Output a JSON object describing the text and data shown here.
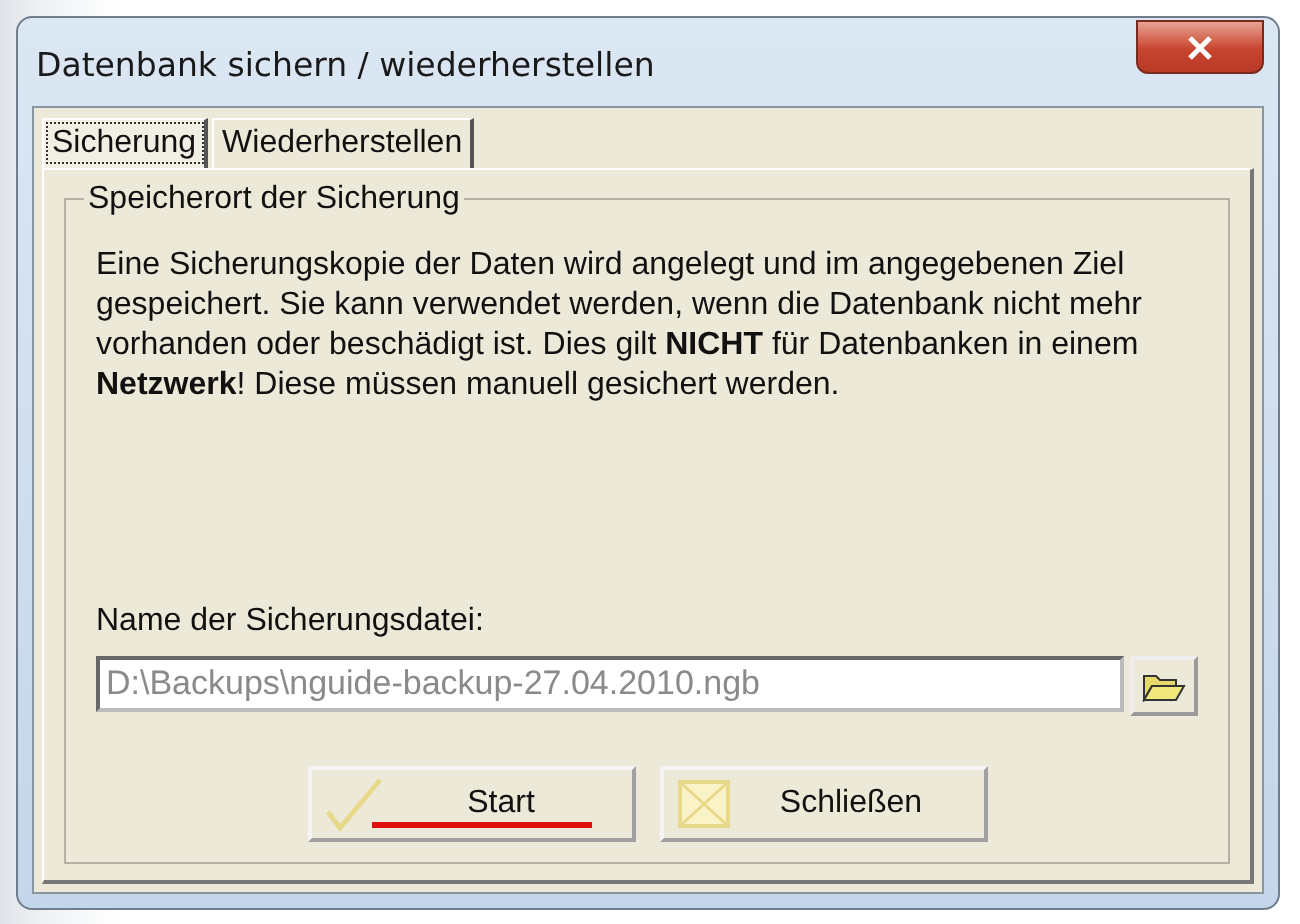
{
  "window": {
    "title": "Datenbank sichern / wiederherstellen"
  },
  "tabs": [
    {
      "label": "Sicherung",
      "selected": true
    },
    {
      "label": "Wiederherstellen",
      "selected": false
    }
  ],
  "group": {
    "title": "Speicherort der Sicherung",
    "text": "Eine Sicherungskopie der Daten wird angelegt und im angegebenen Ziel gespeichert. Sie kann verwendet werden, wenn die Datenbank nicht mehr vorhanden oder beschädigt ist. Dies gilt **NICHT** für Datenbanken in einem **Netzwerk**! Diese müssen manuell gesichert werden."
  },
  "file": {
    "label": "Name der Sicherungsdatei:",
    "value": "D:\\Backups\\nguide-backup-27.04.2010.ngb",
    "disabled": true
  },
  "buttons": [
    {
      "kind": "start",
      "label": "Start"
    },
    {
      "kind": "close",
      "label": "Schließen"
    }
  ]
}
